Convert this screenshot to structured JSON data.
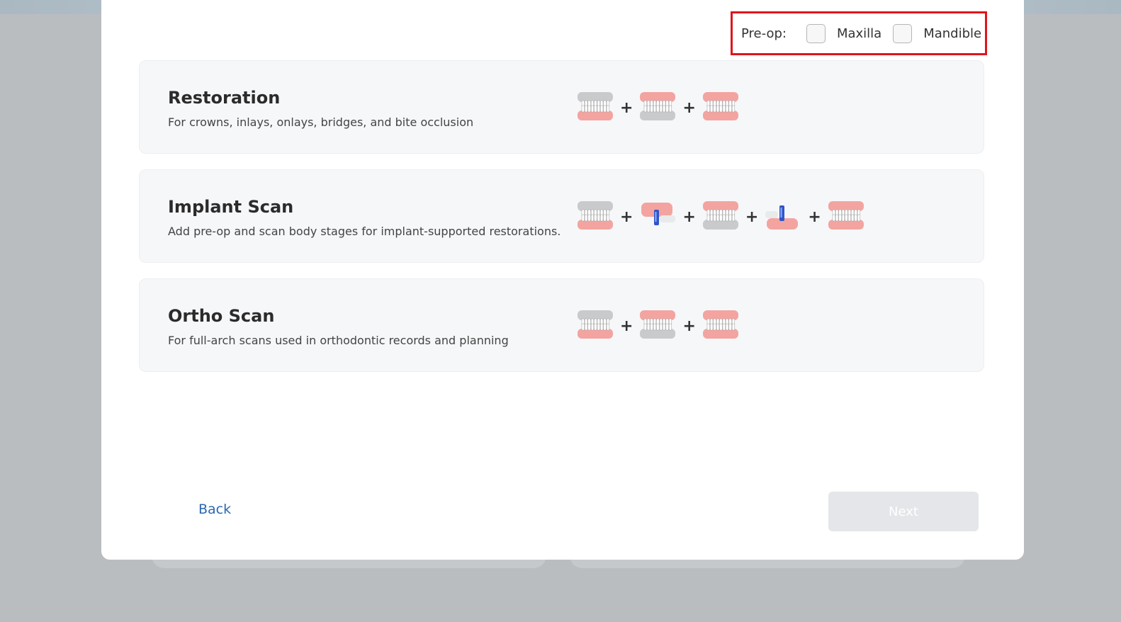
{
  "preop": {
    "label": "Pre-op:",
    "options": [
      {
        "label": "Maxilla",
        "checked": false
      },
      {
        "label": "Mandible",
        "checked": false
      }
    ]
  },
  "cards": [
    {
      "title": "Restoration",
      "description": "For crowns, inlays, onlays, bridges, and bite occlusion",
      "icons": [
        "upper-jaw-highlight-icon",
        "lower-jaw-highlight-icon",
        "bite-icon"
      ]
    },
    {
      "title": "Implant Scan",
      "description": "Add pre-op and scan body stages for implant-supported restorations.",
      "icons": [
        "upper-jaw-highlight-icon",
        "upper-scanbody-icon",
        "lower-jaw-highlight-icon",
        "lower-scanbody-icon",
        "bite-icon"
      ]
    },
    {
      "title": "Ortho Scan",
      "description": "For full-arch scans used in orthodontic records and planning",
      "icons": [
        "upper-jaw-highlight-icon",
        "lower-jaw-highlight-icon",
        "bite-icon"
      ]
    }
  ],
  "plus_symbol": "+",
  "footer": {
    "back_label": "Back",
    "next_label": "Next"
  },
  "colors": {
    "highlight_border": "#e0141c",
    "gum": "#f3a4a0",
    "scanbody": "#2f55c8",
    "link": "#2a68b0"
  }
}
